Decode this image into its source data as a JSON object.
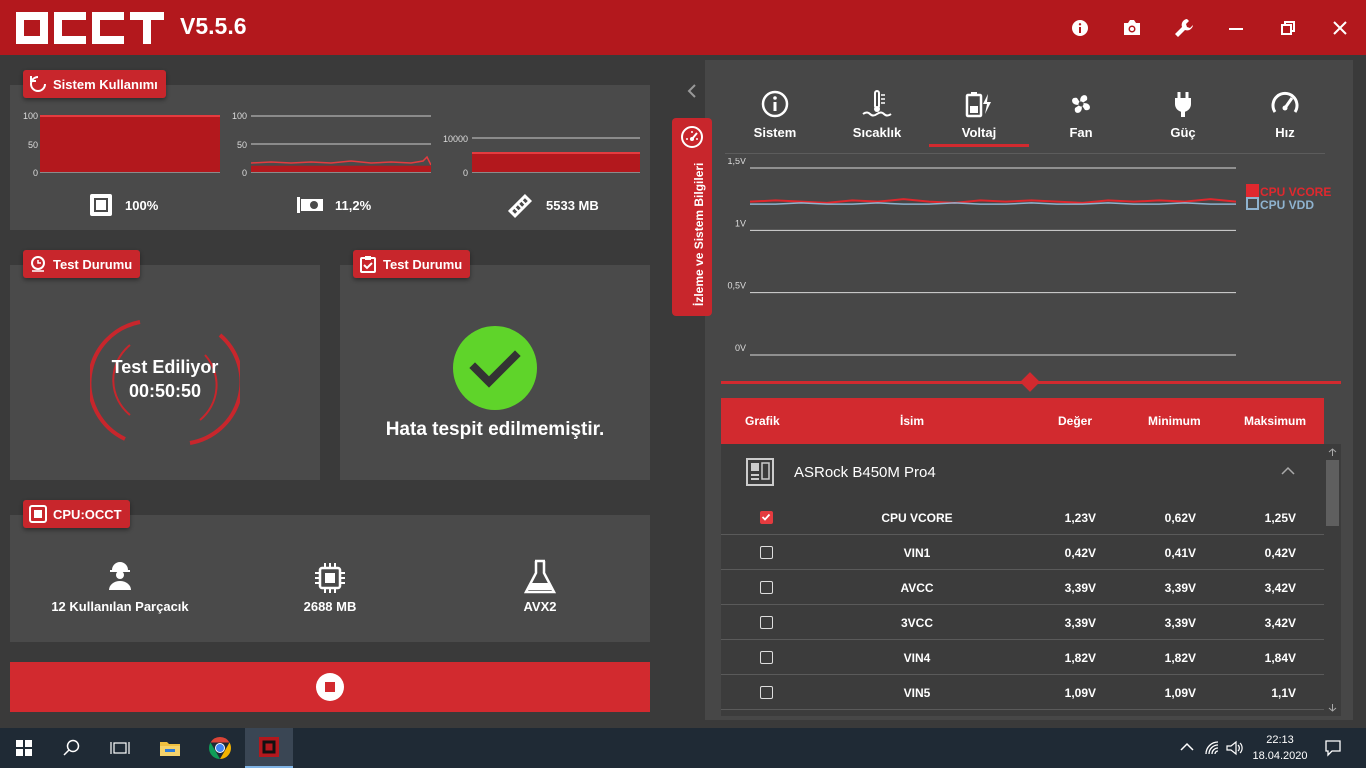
{
  "app": {
    "logo_text": "OCCT",
    "version": "V5.5.6"
  },
  "window_controls": [
    "info-icon",
    "camera-icon",
    "wrench-icon",
    "minimize-icon",
    "restore-icon",
    "close-icon"
  ],
  "usage_panel": {
    "title": "Sistem Kullanımı",
    "cpu": {
      "value_label": "100%",
      "axis": [
        "100",
        "50",
        "0"
      ],
      "level": 1.0
    },
    "gpu": {
      "value_label": "11,2%",
      "axis": [
        "100",
        "50",
        "0"
      ],
      "level": 0.112
    },
    "ram": {
      "value_label": "5533 MB",
      "axis": [
        "10000",
        "0"
      ],
      "level": 0.55
    }
  },
  "test_status_panel": {
    "title": "Test Durumu",
    "status": "Test Ediliyor",
    "elapsed": "00:50:50"
  },
  "error_panel": {
    "title": "Test Durumu",
    "message": "Hata tespit edilmemiştir."
  },
  "cpu_panel": {
    "title": "CPU:OCCT",
    "threads_count": "12",
    "threads_label": "Kullanılan Parçacık",
    "memory_value": "2688",
    "memory_unit": "MB",
    "instruction_set": "AVX2"
  },
  "side_tab": {
    "label": "İzleme ve Sistem Bilgileri"
  },
  "monitor": {
    "tabs": [
      {
        "label": "Sistem",
        "icon": "info-circle-icon"
      },
      {
        "label": "Sıcaklık",
        "icon": "thermometer-icon"
      },
      {
        "label": "Voltaj",
        "icon": "battery-bolt-icon",
        "active": true
      },
      {
        "label": "Fan",
        "icon": "fan-icon"
      },
      {
        "label": "Güç",
        "icon": "plug-icon"
      },
      {
        "label": "Hız",
        "icon": "speedometer-icon"
      }
    ],
    "chart_axis": [
      "1,5V",
      "1V",
      "0,5V",
      "0V"
    ],
    "legend": [
      "CPU VCORE",
      "CPU VDD"
    ]
  },
  "chart_data": {
    "type": "line",
    "ylim": [
      0,
      1.5
    ],
    "ytick_labels": [
      "0V",
      "0,5V",
      "1V",
      "1,5V"
    ],
    "series": [
      {
        "name": "CPU VCORE",
        "values": [
          1.23,
          1.24,
          1.23,
          1.22,
          1.24,
          1.23,
          1.25,
          1.23,
          1.22,
          1.24,
          1.23,
          1.24,
          1.23,
          1.22,
          1.24,
          1.23,
          1.24,
          1.23,
          1.25,
          1.23
        ]
      },
      {
        "name": "CPU VDD",
        "values": [
          1.21,
          1.21,
          1.22,
          1.21,
          1.21,
          1.22,
          1.21,
          1.21,
          1.22,
          1.21,
          1.21,
          1.22,
          1.21,
          1.21,
          1.22,
          1.21,
          1.21,
          1.22,
          1.21,
          1.21
        ]
      }
    ],
    "colors": [
      "#e0282e",
      "#8fb3cf"
    ]
  },
  "sensor_table": {
    "headers": {
      "graph": "Grafik",
      "name": "İsim",
      "value": "Değer",
      "min": "Minimum",
      "max": "Maksimum"
    },
    "device": "ASRock B450M Pro4",
    "rows": [
      {
        "name": "CPU VCORE",
        "value": "1,23V",
        "min": "0,62V",
        "max": "1,25V",
        "checked": true
      },
      {
        "name": "VIN1",
        "value": "0,42V",
        "min": "0,41V",
        "max": "0,42V",
        "checked": false
      },
      {
        "name": "AVCC",
        "value": "3,39V",
        "min": "3,39V",
        "max": "3,42V",
        "checked": false
      },
      {
        "name": "3VCC",
        "value": "3,39V",
        "min": "3,39V",
        "max": "3,42V",
        "checked": false
      },
      {
        "name": "VIN4",
        "value": "1,82V",
        "min": "1,82V",
        "max": "1,84V",
        "checked": false
      },
      {
        "name": "VIN5",
        "value": "1,09V",
        "min": "1,09V",
        "max": "1,1V",
        "checked": false
      }
    ]
  },
  "taskbar": {
    "time": "22:13",
    "date": "18.04.2020"
  },
  "colors": {
    "brand_red": "#b3181d",
    "accent_red": "#d22a2f",
    "ok_green": "#5fd42a",
    "panel": "#4a4a4a"
  }
}
